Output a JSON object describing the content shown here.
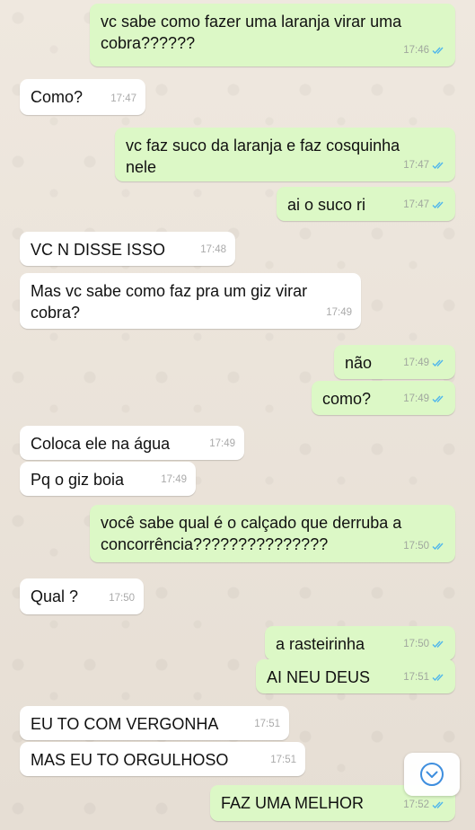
{
  "messages": [
    {
      "dir": "out",
      "text": "vc sabe como fazer uma laranja virar uma\ncobra??????",
      "time": "17:46"
    },
    {
      "dir": "in",
      "text": "Como?",
      "time": "17:47"
    },
    {
      "dir": "out",
      "text": "vc faz suco da laranja e faz cosquinha\nnele",
      "time": "17:47"
    },
    {
      "dir": "out",
      "text": "ai o suco ri",
      "time": "17:47"
    },
    {
      "dir": "in",
      "text": "VC N DISSE ISSO",
      "time": "17:48"
    },
    {
      "dir": "in",
      "text": "Mas vc sabe como faz pra um giz virar\ncobra?",
      "time": "17:49"
    },
    {
      "dir": "out",
      "text": "não",
      "time": "17:49"
    },
    {
      "dir": "out",
      "text": "como?",
      "time": "17:49"
    },
    {
      "dir": "in",
      "text": "Coloca ele na água",
      "time": "17:49"
    },
    {
      "dir": "in",
      "text": "Pq o giz boia",
      "time": "17:49"
    },
    {
      "dir": "out",
      "text": "você sabe qual é o calçado que derruba a\nconcorrência???????????????",
      "time": "17:50"
    },
    {
      "dir": "in",
      "text": "Qual ?",
      "time": "17:50"
    },
    {
      "dir": "out",
      "text": "a rasteirinha",
      "time": "17:50"
    },
    {
      "dir": "out",
      "text": "AI NEU DEUS",
      "time": "17:51"
    },
    {
      "dir": "in",
      "text": "EU TO COM VERGONHA",
      "time": "17:51"
    },
    {
      "dir": "in",
      "text": "MAS EU TO ORGULHOSO",
      "time": "17:51"
    },
    {
      "dir": "out",
      "text": "FAZ UMA MELHOR",
      "time": "17:52"
    }
  ],
  "colors": {
    "outgoing": "#DCF8C6",
    "incoming": "#FFFFFF",
    "read_ticks": "#4FB6EC"
  },
  "icons": {
    "read_receipt": "double-check-icon",
    "scroll_down": "chevron-down-icon"
  }
}
